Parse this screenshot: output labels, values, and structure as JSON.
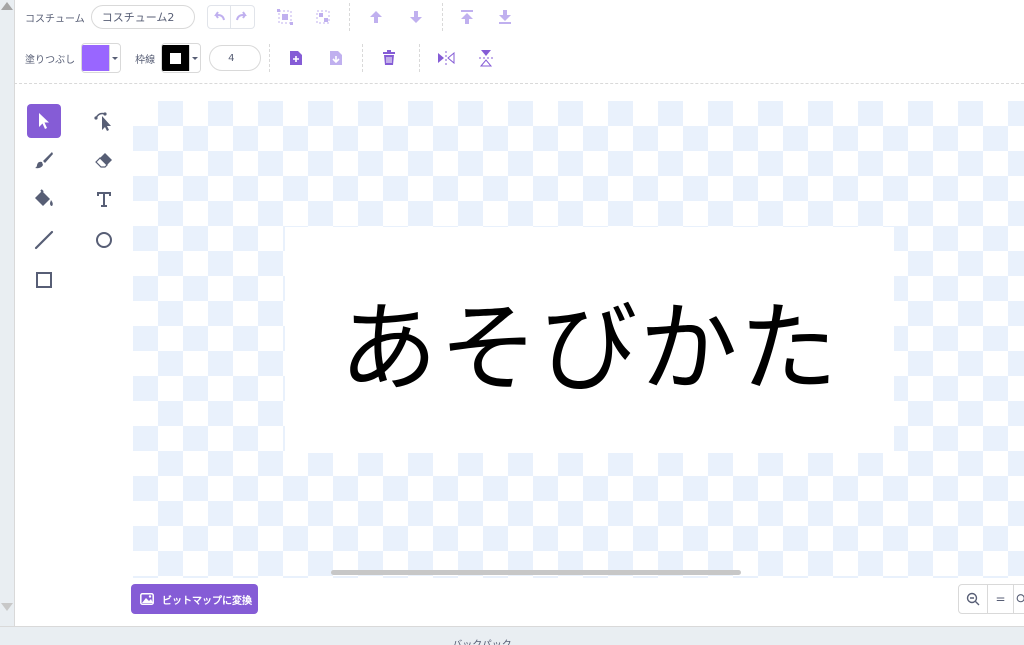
{
  "toolbar": {
    "costume_label": "コスチューム",
    "costume_name": "コスチューム2",
    "fill_label": "塗りつぶし",
    "fill_color": "#9966ff",
    "outline_label": "枠線",
    "outline_color": "#000000",
    "outline_width": "4"
  },
  "tools": [
    {
      "name": "select",
      "icon": "arrow-pointer-icon",
      "active": true
    },
    {
      "name": "reshape",
      "icon": "reshape-icon",
      "active": false
    },
    {
      "name": "brush",
      "icon": "brush-icon",
      "active": false
    },
    {
      "name": "eraser",
      "icon": "eraser-icon",
      "active": false
    },
    {
      "name": "fill",
      "icon": "paint-bucket-icon",
      "active": false
    },
    {
      "name": "text",
      "icon": "text-icon",
      "active": false
    },
    {
      "name": "line",
      "icon": "line-icon",
      "active": false
    },
    {
      "name": "circle",
      "icon": "circle-icon",
      "active": false
    },
    {
      "name": "rectangle",
      "icon": "rectangle-icon",
      "active": false
    }
  ],
  "canvas": {
    "text": "あそびかた"
  },
  "convert_button": "ビットマップに変換",
  "zoom": {
    "reset_label": "="
  },
  "bottom_tab": "バックパック",
  "colors": {
    "accent": "#855cd6",
    "fill_swatch": "#9966ff",
    "icon_purple": "#a991e6"
  }
}
